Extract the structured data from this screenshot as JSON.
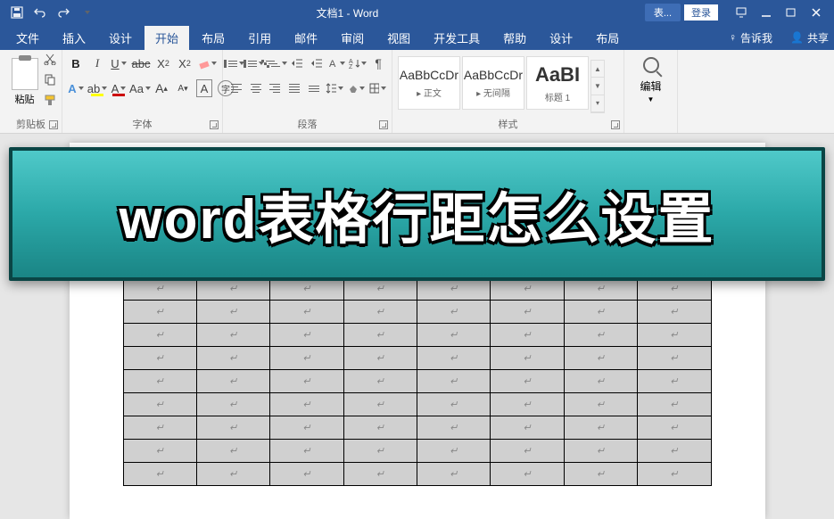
{
  "titlebar": {
    "document_title": "文档1 - Word",
    "tool_tab": "表...",
    "login": "登录"
  },
  "menu": {
    "file": "文件",
    "insert": "插入",
    "design": "设计",
    "home": "开始",
    "layout": "布局",
    "references": "引用",
    "mailings": "邮件",
    "review": "审阅",
    "view": "视图",
    "developer": "开发工具",
    "help": "帮助",
    "table_design": "设计",
    "table_layout": "布局",
    "tell_me": "告诉我",
    "share": "共享"
  },
  "ribbon": {
    "clipboard": {
      "label": "剪贴板",
      "paste": "粘贴"
    },
    "font": {
      "label": "字体",
      "bold": "B",
      "italic": "I",
      "underline": "U",
      "strike": "abc",
      "sub": "X",
      "sup": "X",
      "effects": "A",
      "highlight": "ab",
      "color": "A",
      "change_case": "Aa",
      "grow": "A",
      "shrink": "A",
      "char_border": "A",
      "clear": "A"
    },
    "paragraph": {
      "label": "段落"
    },
    "styles": {
      "label": "样式",
      "items": [
        {
          "preview": "AaBbCcDr",
          "name": "▸ 正文"
        },
        {
          "preview": "AaBbCcDr",
          "name": "▸ 无间隔"
        },
        {
          "preview": "AaBI",
          "name": "标题 1"
        }
      ]
    },
    "editing": {
      "label": "编辑"
    }
  },
  "overlay": {
    "text": "word表格行距怎么设置"
  },
  "table": {
    "rows": 14,
    "cols": 8,
    "cell_marker": "↵"
  }
}
